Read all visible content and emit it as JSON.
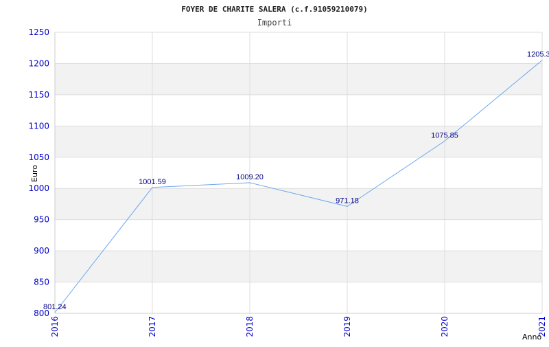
{
  "chart_data": {
    "type": "line",
    "title": "FOYER DE CHARITE SALERA (c.f.91059210079)",
    "subtitle": "Importi",
    "xlabel": "Anno",
    "ylabel": "Euro",
    "x": [
      "2016",
      "2017",
      "2018",
      "2019",
      "2020",
      "2021"
    ],
    "series": [
      {
        "values": [
          801.24,
          1001.59,
          1009.2,
          971.18,
          1075.85,
          1205.3
        ],
        "labels": [
          "801.24",
          "1001.59",
          "1009.20",
          "971.18",
          "1075.85",
          "1205.3"
        ]
      }
    ],
    "ylim": [
      800,
      1250
    ],
    "yticks": [
      "800",
      "850",
      "900",
      "950",
      "1000",
      "1050",
      "1100",
      "1150",
      "1200",
      "1250"
    ],
    "grid": true,
    "colors": {
      "line": "#6aa8ee",
      "band": "#f2f2f2",
      "gridline": "#dddddd",
      "tick_text": "#0000cc",
      "data_label": "#000080"
    }
  }
}
